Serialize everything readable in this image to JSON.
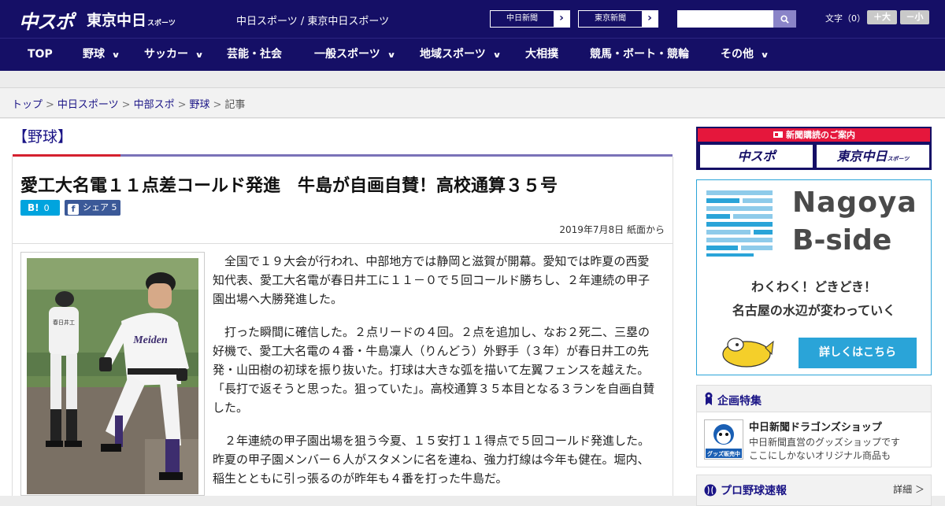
{
  "header": {
    "logo_chuspo": "中スポ",
    "logo_tokyo": "東京中日",
    "logo_tokyo_suffix": "スポーツ",
    "site_title": "中日スポーツ / 東京中日スポーツ",
    "paper_buttons": [
      "中日新聞",
      "東京新聞"
    ],
    "search_placeholder": "",
    "font_size_label": "文字（0）",
    "font_plus": "＋大",
    "font_minus": "－小"
  },
  "nav": {
    "items": [
      "TOP",
      "野球",
      "サッカー",
      "芸能・社会",
      "一般スポーツ",
      "地域スポーツ",
      "大相撲",
      "競馬・ボート・競輪",
      "その他"
    ]
  },
  "breadcrumb": {
    "items": [
      "トップ",
      "中日スポーツ",
      "中部スポ",
      "野球"
    ],
    "current": "記事"
  },
  "article": {
    "category": "【野球】",
    "headline": "愛工大名電１１点差コールド発進　牛島が自画自賛！高校通算３５号",
    "hatena_count": "0",
    "hatena_label": "B!",
    "fb_label": "シェア",
    "fb_count": "5",
    "date": "2019年7月8日 紙面から",
    "paragraphs": [
      "全国で１９大会が行われ、中部地方では静岡と滋賀が開幕。愛知では昨夏の西愛知代表、愛工大名電が春日井工に１１－０で５回コールド勝ちし、２年連続の甲子園出場へ大勝発進した。",
      "打った瞬間に確信した。２点リードの４回。２点を追加し、なお２死二、三塁の好機で、愛工大名電の４番・牛島凜人（りんどう）外野手（３年）が春日井工の先発・山田樹の初球を振り抜いた。打球は大きな弧を描いて左翼フェンスを越えた。「長打で返そうと思った。狙っていた」。高校通算３５本目となる３ランを自画自賛した。",
      "２年連続の甲子園出場を狙う今夏、１５安打１１得点で５回コールド発進した。昨夏の甲子園メンバー６人がスタメンに名を連ね、強力打線は今年も健在。堀内、稲生とともに引っ張るのが昨年も４番を打った牛島だ。"
    ],
    "photo_text": {
      "uniform_main": "Meiden",
      "uniform_back": "春日井工"
    }
  },
  "sidebar": {
    "ad_top": {
      "head": "新聞購読のご案内",
      "btn1": "中スポ",
      "btn2": "東京中日",
      "btn2_suffix": "スポーツ"
    },
    "bside": {
      "title1": "Nagoya",
      "title2": "B-side",
      "catch1": "わくわく！どきどき！",
      "catch2": "名古屋の水辺が変わっていく",
      "button": "詳しくはこちら"
    },
    "feature": {
      "head": "企画特集",
      "shop_title": "中日新聞ドラゴンズショップ",
      "shop_desc1": "中日新聞直営のグッズショップです",
      "shop_desc2": "ここにしかないオリジナル商品も",
      "shop_icon_text": "グッズ販売中"
    },
    "score": {
      "head": "プロ野球速報",
      "more": "詳細 ＞"
    }
  },
  "colors": {
    "brand_navy": "#150f66",
    "accent_red": "#d4212f",
    "bside_blue": "#2aa4d8"
  }
}
